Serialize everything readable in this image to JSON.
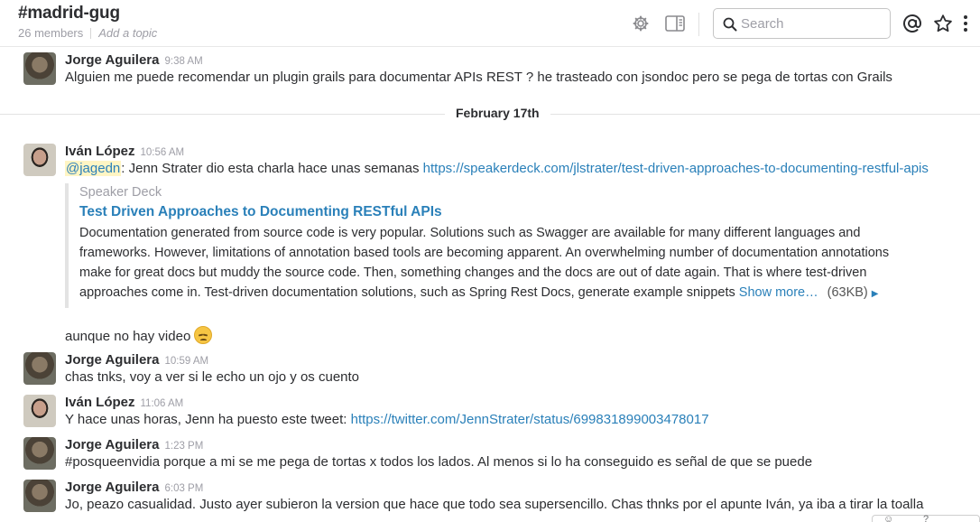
{
  "header": {
    "channel": "#madrid-gug",
    "members": "26 members",
    "topic": "Add a topic",
    "search_placeholder": "Search"
  },
  "date_divider": "February 17th",
  "messages": [
    {
      "author": "Jorge Aguilera",
      "time": "9:38 AM",
      "text": "Alguien me puede recomendar un plugin grails para documentar APIs REST ? he trasteado con jsondoc pero se pega de tortas con Grails"
    },
    {
      "author": "Iván López",
      "time": "10:56 AM",
      "mention": "@jagedn",
      "text": ": Jenn Strater dio esta charla hace unas semanas ",
      "link": "https://speakerdeck.com/jlstrater/test-driven-approaches-to-documenting-restful-apis"
    },
    {
      "text": "aunque no hay video"
    },
    {
      "author": "Jorge Aguilera",
      "time": "10:59 AM",
      "text": "chas tnks, voy a ver si le echo un ojo y os cuento"
    },
    {
      "author": "Iván López",
      "time": "11:06 AM",
      "text": "Y hace unas horas, Jenn ha puesto este tweet: ",
      "link": "https://twitter.com/JennStrater/status/699831899003478017"
    },
    {
      "author": "Jorge Aguilera",
      "time": "1:23 PM",
      "text": "#posqueenvidia porque a mi se me pega de tortas x todos los lados. Al menos si lo ha conseguido es señal de que se puede"
    },
    {
      "author": "Jorge Aguilera",
      "time": "6:03 PM",
      "text": "Jo, peazo casualidad. Justo ayer subieron la version que hace que todo sea supersencillo. Chas thnks por el apunte Iván, ya iba a tirar la toalla"
    }
  ],
  "attachment": {
    "service": "Speaker Deck",
    "title": "Test Driven Approaches to Documenting RESTful APIs",
    "body": "Documentation generated from source code is very popular. Solutions such as Swagger are available for many different languages and frameworks. However, limitations of annotation based tools are becoming apparent. An overwhelming number of documentation annotations make for great docs but muddy the source code. Then, something changes and the docs are out of date again. That is where test-driven approaches come in. Test-driven documentation solutions, such as Spring Rest Docs, generate example snippets ",
    "show_more": "Show more…",
    "size": "(63KB)"
  },
  "icons": [
    "gear-icon",
    "sidebar-toggle-icon",
    "search-icon",
    "at-mention-icon",
    "star-icon",
    "kebab-menu-icon",
    "sad-emoji-icon"
  ],
  "colors": {
    "link": "#2a80b9",
    "mention_bg": "#fff5c4",
    "muted": "#9e9ea6",
    "text": "#2c2d30"
  }
}
